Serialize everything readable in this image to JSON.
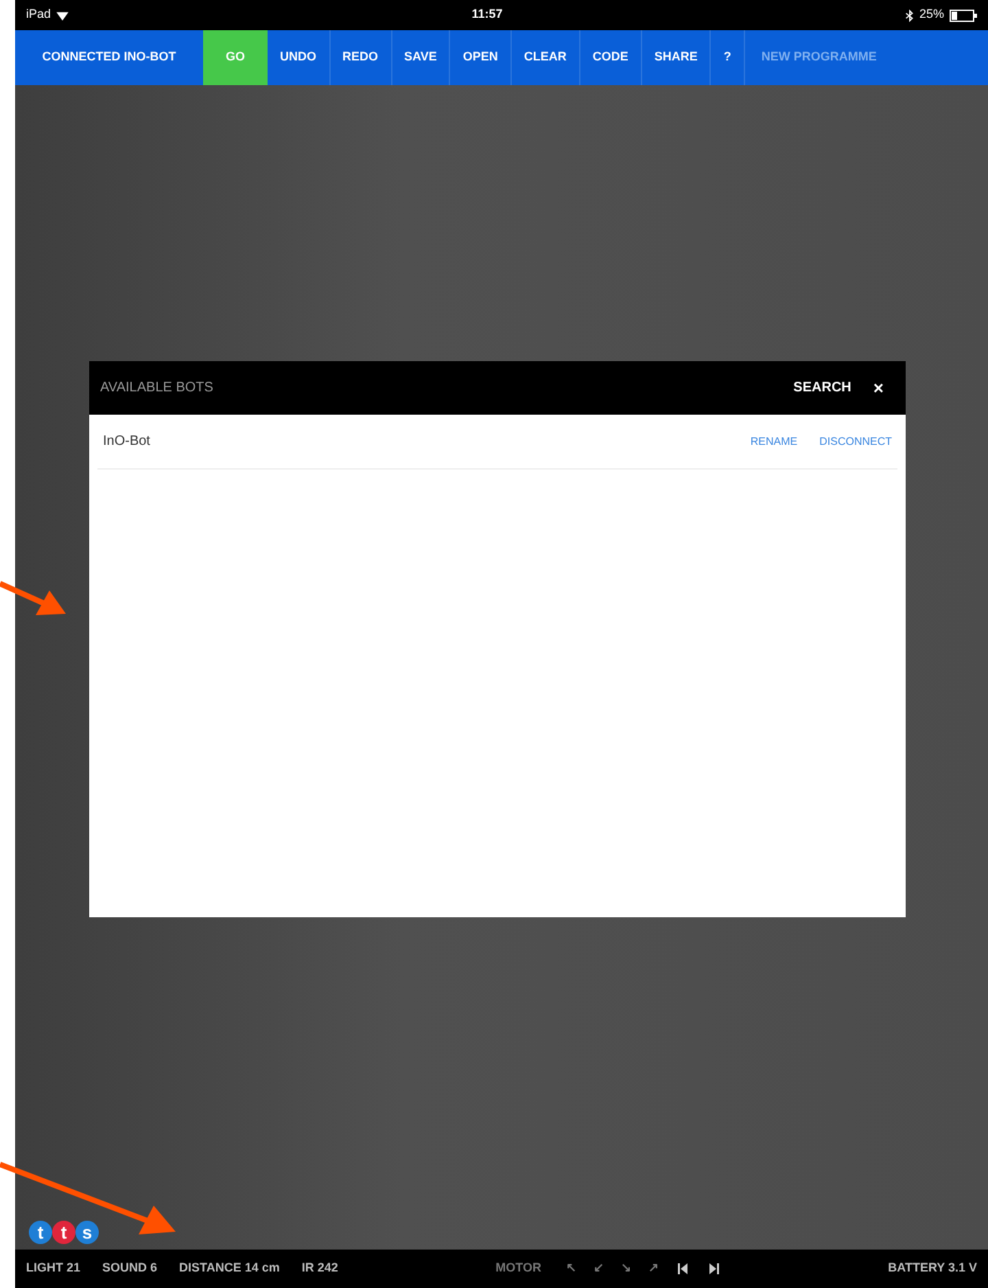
{
  "status_bar": {
    "device": "iPad",
    "time": "11:57",
    "battery": "25%"
  },
  "toolbar": {
    "items": [
      {
        "kind": "status",
        "label": "CONNECTED INO-BOT"
      },
      {
        "kind": "go",
        "label": "GO"
      },
      {
        "kind": "action",
        "label": "UNDO"
      },
      {
        "kind": "action",
        "label": "REDO"
      },
      {
        "kind": "action",
        "label": "SAVE"
      },
      {
        "kind": "action",
        "label": "OPEN"
      },
      {
        "kind": "action",
        "label": "CLEAR"
      },
      {
        "kind": "action",
        "label": "CODE"
      },
      {
        "kind": "action",
        "label": "SHARE"
      },
      {
        "kind": "action",
        "label": "?"
      },
      {
        "kind": "name",
        "label": "NEW PROGRAMME"
      }
    ]
  },
  "dialog": {
    "title": "AVAILABLE BOTS",
    "search": "SEARCH",
    "close": "×",
    "bots": [
      {
        "name": "InO-Bot",
        "actions": [
          "RENAME",
          "DISCONNECT"
        ]
      }
    ]
  },
  "logo": {
    "letters": [
      {
        "char": "t",
        "color": "#1f7fd6"
      },
      {
        "char": "t",
        "color": "#e0263c"
      },
      {
        "char": "s",
        "color": "#1f7fd6"
      }
    ]
  },
  "sensor_bar": {
    "readings": [
      "LIGHT 21",
      "SOUND 6",
      "DISTANCE 14 cm",
      "IR 242"
    ],
    "motor": "MOTOR",
    "directions": [
      "↖",
      "↙",
      "↘",
      "↗"
    ],
    "battery": "BATTERY 3.1 V"
  }
}
